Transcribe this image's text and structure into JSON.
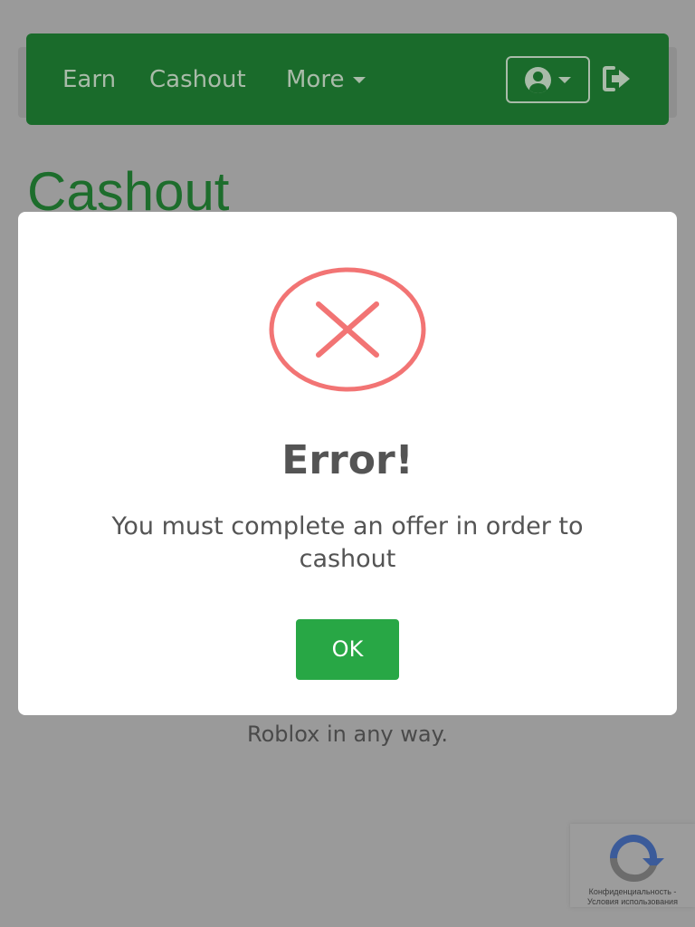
{
  "navbar": {
    "links": [
      "Earn",
      "Cashout",
      "More"
    ],
    "user_menu_icon": "user-circle-icon",
    "logout_icon": "sign-out-icon"
  },
  "page": {
    "title": "Cashout",
    "footer_text": "Roblox in any way."
  },
  "modal": {
    "icon": "error-x-icon",
    "title": "Error!",
    "message": "You must complete an offer in order to cashout",
    "ok_label": "OK"
  },
  "recaptcha": {
    "line1": "Конфиденциальность -",
    "line2": "Условия использования"
  },
  "colors": {
    "navbar": "#1a6b2b",
    "overlay": "#9a9a9a",
    "error_red": "#f27474",
    "ok_green": "#28a745"
  }
}
